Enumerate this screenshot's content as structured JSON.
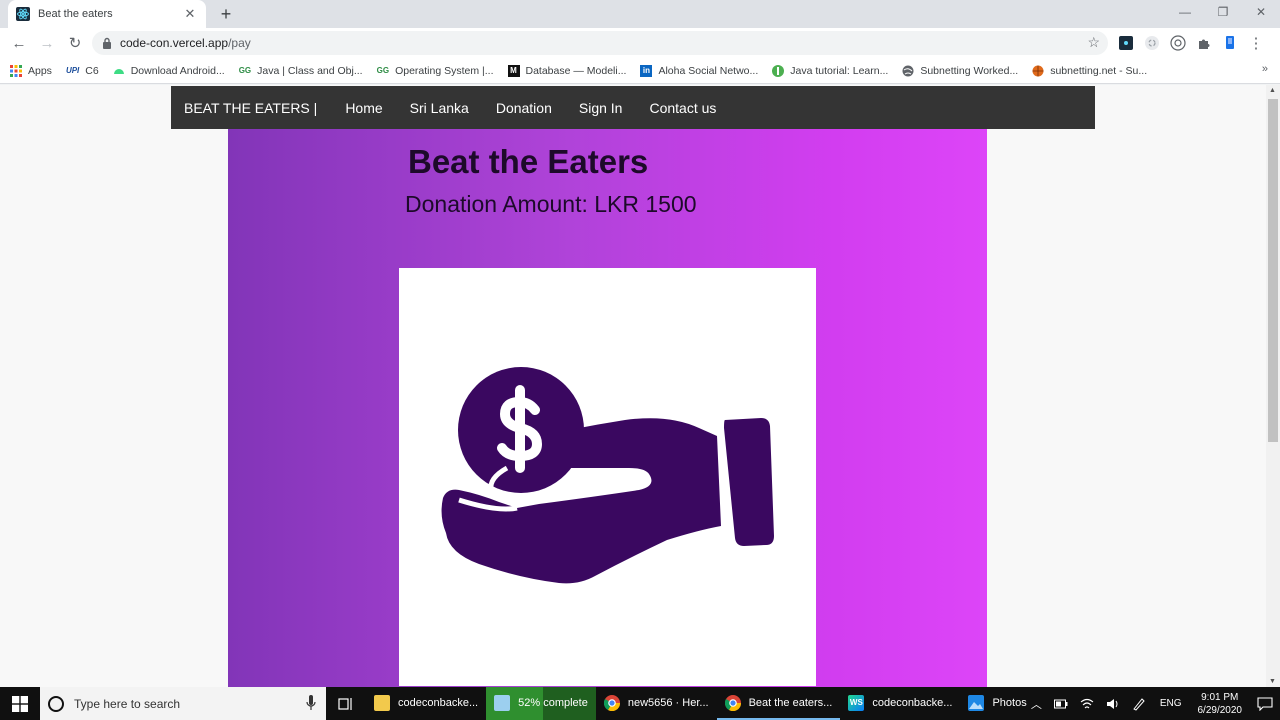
{
  "browser": {
    "tab": {
      "title": "Beat the eaters",
      "close": "✕"
    },
    "new_tab": "+",
    "window_controls": {
      "minimize": "—",
      "restore": "❐",
      "close": "✕"
    },
    "nav": {
      "back": "←",
      "forward": "→",
      "reload": "↻"
    },
    "url": {
      "host": "code-con.vercel.app",
      "path": "/pay"
    },
    "star": "☆",
    "menu": "⋮",
    "bookmarks": [
      {
        "label": "Apps",
        "icon": "apps-grid-icon"
      },
      {
        "label": "C6",
        "icon": "upi-icon",
        "prefix": "UPI"
      },
      {
        "label": "Download Android...",
        "icon": "android-icon"
      },
      {
        "label": "Java | Class and Obj...",
        "icon": "gfg-icon",
        "prefix": "GG"
      },
      {
        "label": "Operating System |...",
        "icon": "gfg-icon",
        "prefix": "GG"
      },
      {
        "label": "Database — Modeli...",
        "icon": "medium-icon",
        "prefix": "M"
      },
      {
        "label": "Aloha Social Netwo...",
        "icon": "linkedin-icon",
        "prefix": "in"
      },
      {
        "label": "Java tutorial: Learn...",
        "icon": "green-globe-icon"
      },
      {
        "label": "Subnetting Worked...",
        "icon": "globe-icon"
      },
      {
        "label": "subnetting.net - Su...",
        "icon": "basketball-icon"
      }
    ],
    "bookmarks_more": "»"
  },
  "site": {
    "brand": "BEAT THE EATERS |",
    "nav_links": [
      "Home",
      "Sri Lanka",
      "Donation",
      "Sign In",
      "Contact us"
    ],
    "title": "Beat the Eaters",
    "amount_text": "Donation Amount: LKR 1500"
  },
  "taskbar": {
    "search_placeholder": "Type here to search",
    "items": [
      {
        "label": "codeconbacke...",
        "icon": "file-explorer-icon"
      },
      {
        "label": "52% complete",
        "icon": "copy-progress-icon",
        "progress": 0.52
      },
      {
        "label": "new5656 · Her...",
        "icon": "chrome-icon"
      },
      {
        "label": "Beat the eaters...",
        "icon": "chrome-icon",
        "active": true
      },
      {
        "label": "codeconbacke...",
        "icon": "webstorm-icon"
      },
      {
        "label": "Photos",
        "icon": "photos-icon"
      }
    ],
    "lang": "ENG",
    "time": "9:01 PM",
    "date": "6/29/2020"
  },
  "colors": {
    "navbar": "#343434",
    "hero_gradient_start": "#8235b8",
    "hero_gradient_end": "#dd45f8",
    "icon_purple": "#3a0860"
  }
}
